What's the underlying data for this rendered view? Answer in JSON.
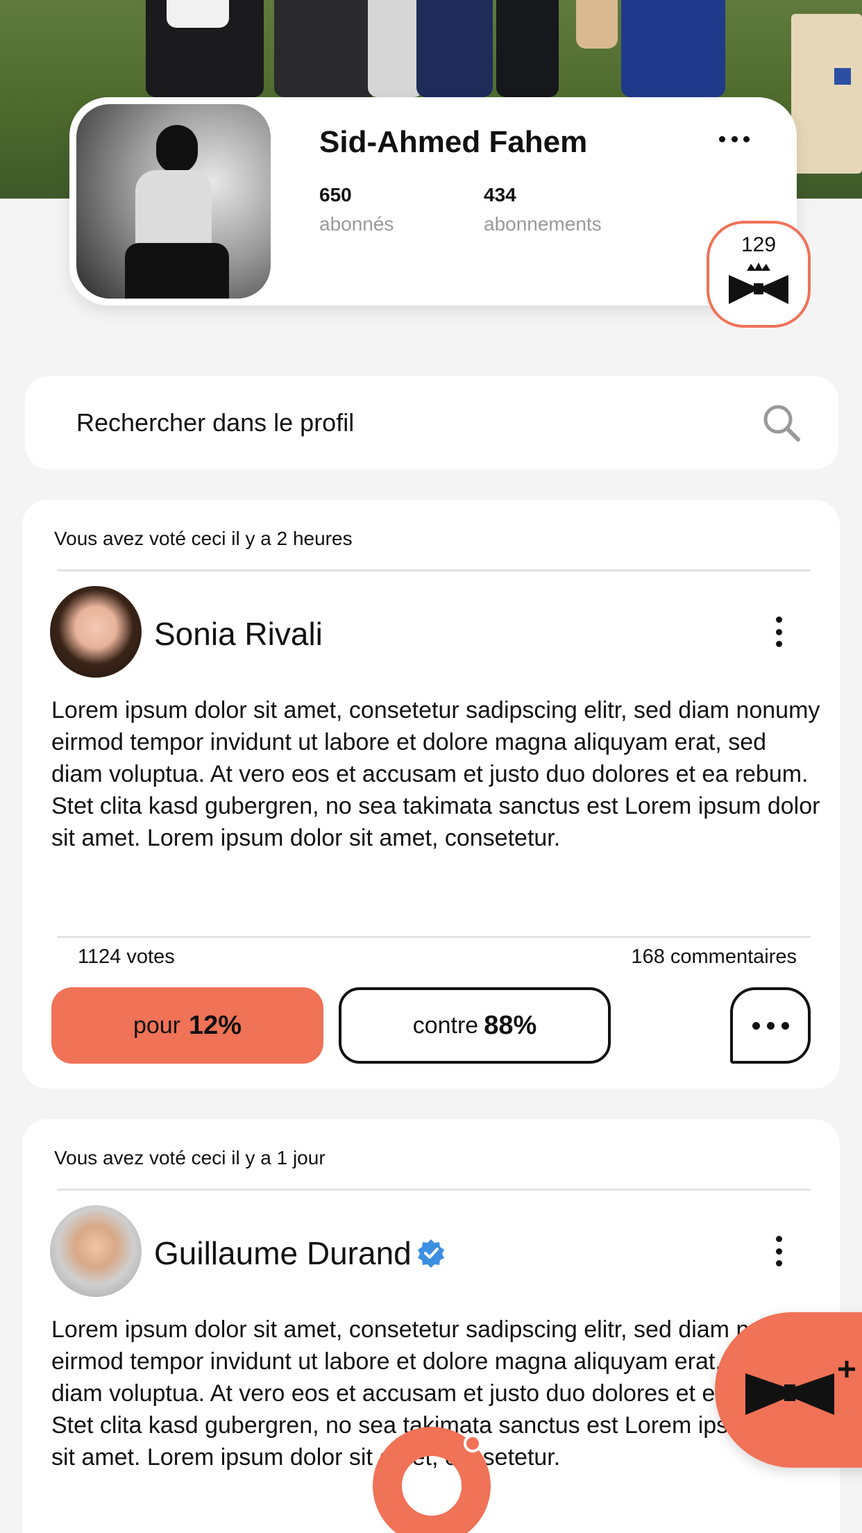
{
  "profile": {
    "name": "Sid-Ahmed Fahem",
    "followers_count": "650",
    "followers_label": "abonnés",
    "following_count": "434",
    "following_label": "abonnements",
    "badge_count": "129"
  },
  "search": {
    "placeholder": "Rechercher dans le profil"
  },
  "posts": [
    {
      "voted_label": "Vous avez voté ceci il y a 2 heures",
      "author": "Sonia Rivali",
      "verified": false,
      "text": "Lorem ipsum dolor sit amet, consetetur sadipscing elitr, sed diam nonumy eirmod tempor invidunt ut labore et dolore magna aliquyam erat, sed diam voluptua. At vero eos et accusam et justo duo dolores et ea rebum. Stet clita kasd gubergren, no sea takimata sanctus est Lorem ipsum dolor sit amet. Lorem ipsum dolor sit amet, consetetur.",
      "votes": "1124 votes",
      "comments": "168 commentaires",
      "for_label": "pour",
      "for_pct": "12%",
      "against_label": "contre",
      "against_pct": "88%"
    },
    {
      "voted_label": "Vous avez voté ceci il y a 1 jour",
      "author": "Guillaume Durand",
      "verified": true,
      "text": "Lorem ipsum dolor sit amet, consetetur sadipscing elitr, sed diam nonumy eirmod tempor invidunt ut labore et dolore magna aliquyam erat, sed diam voluptua. At vero eos et accusam et justo duo dolores et ea rebum. Stet clita kasd gubergren, no sea takimata sanctus est Lorem ipsum dolor sit amet. Lorem ipsum dolor sit amet, consetetur."
    }
  ],
  "colors": {
    "accent": "#f07257",
    "verified": "#3b8fe0",
    "background": "#f4f4f4"
  },
  "icons": {
    "profile_more": "more-horizontal-icon",
    "badge": "crown-bowtie-icon",
    "search": "search-icon",
    "post_menu": "more-vertical-icon",
    "comment": "comment-bubble-icon",
    "fab": "bowtie-plus-icon",
    "verified": "verified-check-icon"
  }
}
